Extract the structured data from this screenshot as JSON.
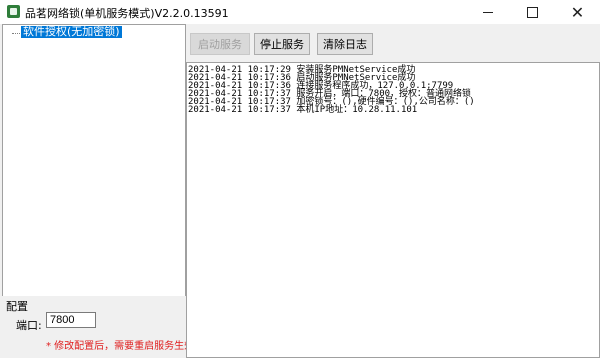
{
  "window": {
    "title": "品茗网络锁(单机服务模式)V2.2.0.13591",
    "minimize_icon": "minimize-icon",
    "maximize_icon": "maximize-icon",
    "close_icon": "close-icon",
    "close_glyph": "✕"
  },
  "tree": {
    "node_label": "软件授权(无加密锁)"
  },
  "config": {
    "group_title": "配置",
    "port_label": "端口:",
    "port_value": "7800",
    "warning": "* 修改配置后，需要重启服务生效",
    "warning_color": "#e02020"
  },
  "toolbar": {
    "start_label": "启动服务",
    "stop_label": "停止服务",
    "clear_label": "清除日志"
  },
  "log": {
    "lines": [
      "2021-04-21 10:17:29 安装服务PMNetService成功",
      "2021-04-21 10:17:36 启动服务PMNetService成功",
      "2021-04-21 10:17:36 连接服务程序成功，127.0.0.1:7799",
      "2021-04-21 10:17:37 服务开启，端口：7800，授权：普通网络锁",
      "2021-04-21 10:17:37 加密锁号：(),硬件编号：(),公司名称：()",
      "2021-04-21 10:17:37 本机IP地址：10.28.11.101"
    ]
  },
  "colors": {
    "selection": "#0078d7",
    "panel_bg": "#f0f0f0"
  }
}
